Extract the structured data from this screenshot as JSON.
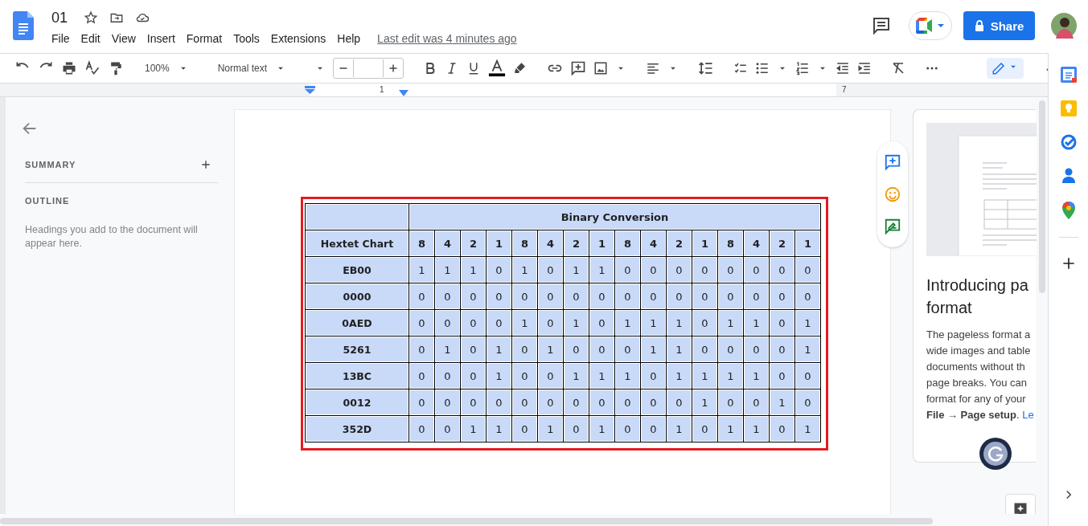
{
  "doc": {
    "title": "01",
    "menus": [
      "File",
      "Edit",
      "View",
      "Insert",
      "Format",
      "Tools",
      "Extensions",
      "Help"
    ],
    "last_edit": "Last edit was 4 minutes ago"
  },
  "share": {
    "label": "Share"
  },
  "toolbar": {
    "zoom": "100%",
    "style": "Normal text"
  },
  "ruler": {
    "marks": [
      "1",
      "7"
    ]
  },
  "sidebar": {
    "summary": "SUMMARY",
    "outline": "OUTLINE",
    "hint": "Headings you add to the document will appear here."
  },
  "table": {
    "group_header": "Binary Conversion",
    "row_header": "Hextet Chart",
    "weights": [
      "8",
      "4",
      "2",
      "1",
      "8",
      "4",
      "2",
      "1",
      "8",
      "4",
      "2",
      "1",
      "8",
      "4",
      "2",
      "1"
    ],
    "rows": [
      {
        "hex": "EB00",
        "bits": [
          "1",
          "1",
          "1",
          "0",
          "1",
          "0",
          "1",
          "1",
          "0",
          "0",
          "0",
          "0",
          "0",
          "0",
          "0",
          "0"
        ]
      },
      {
        "hex": "0000",
        "bits": [
          "0",
          "0",
          "0",
          "0",
          "0",
          "0",
          "0",
          "0",
          "0",
          "0",
          "0",
          "0",
          "0",
          "0",
          "0",
          "0"
        ]
      },
      {
        "hex": "0AED",
        "bits": [
          "0",
          "0",
          "0",
          "0",
          "1",
          "0",
          "1",
          "0",
          "1",
          "1",
          "1",
          "0",
          "1",
          "1",
          "0",
          "1"
        ]
      },
      {
        "hex": "5261",
        "bits": [
          "0",
          "1",
          "0",
          "1",
          "0",
          "1",
          "0",
          "0",
          "0",
          "1",
          "1",
          "0",
          "0",
          "0",
          "0",
          "1"
        ]
      },
      {
        "hex": "13BC",
        "bits": [
          "0",
          "0",
          "0",
          "1",
          "0",
          "0",
          "1",
          "1",
          "1",
          "0",
          "1",
          "1",
          "1",
          "1",
          "0",
          "0"
        ]
      },
      {
        "hex": "0012",
        "bits": [
          "0",
          "0",
          "0",
          "0",
          "0",
          "0",
          "0",
          "0",
          "0",
          "0",
          "0",
          "1",
          "0",
          "0",
          "1",
          "0"
        ]
      },
      {
        "hex": "352D",
        "bits": [
          "0",
          "0",
          "1",
          "1",
          "0",
          "1",
          "0",
          "1",
          "0",
          "0",
          "1",
          "0",
          "1",
          "1",
          "0",
          "1"
        ]
      }
    ]
  },
  "promo": {
    "title_lines": [
      "Introducing pa",
      "format"
    ],
    "body_lines": [
      "The pageless format a",
      "wide images and table",
      "documents without th",
      "page breaks. You can",
      "format for any of your"
    ],
    "last_line": "**File → Page setup**. ",
    "link": "Le"
  }
}
